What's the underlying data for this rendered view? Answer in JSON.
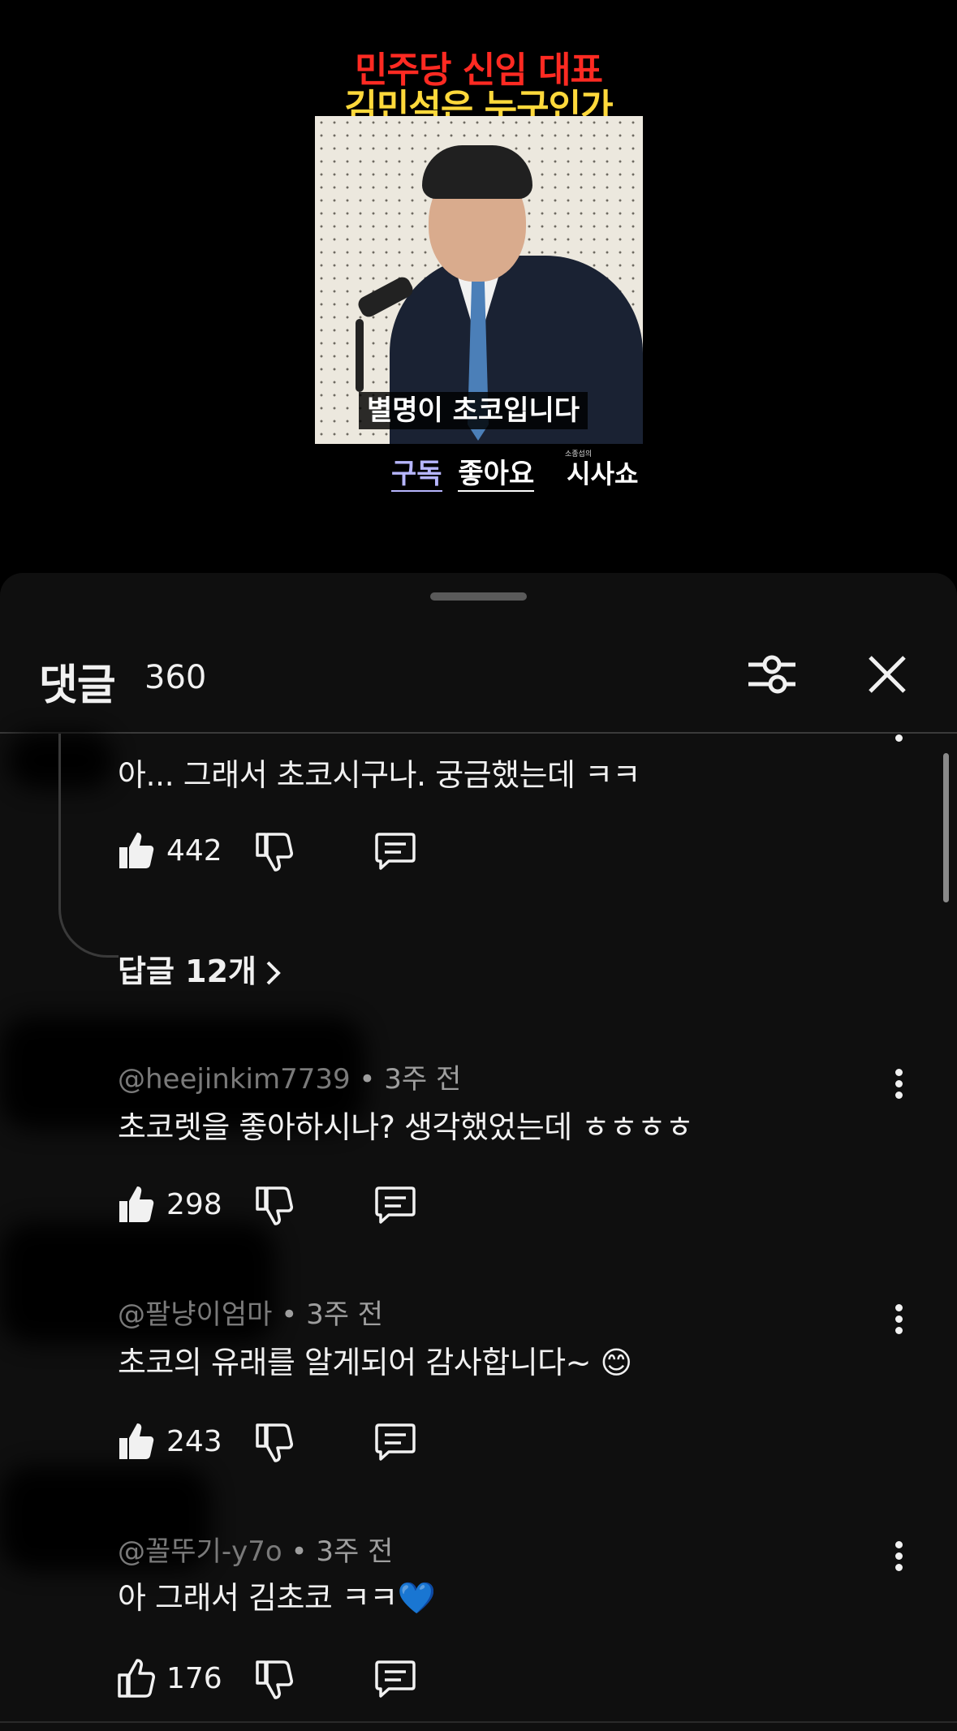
{
  "video": {
    "title_line1": "민주당 신임 대표",
    "title_line2": "김민석은 누구인가",
    "caption": "별명이 초코입니다",
    "subscribe_label": "구독",
    "like_label": "좋아요",
    "channel_small": "소종섭의",
    "channel_name": "시사쇼"
  },
  "comments_panel": {
    "title": "댓글",
    "count": "360",
    "filter_icon": "sliders-icon",
    "close_icon": "close-icon",
    "replies_link": "답글 12개",
    "comments": [
      {
        "user": "",
        "time": "",
        "text": "아... 그래서 초코시구나. 궁금했는데 ㅋㅋ",
        "likes": "442"
      },
      {
        "user": "@heejinkim7739",
        "time": "3주 전",
        "text": "초코렛을 좋아하시나? 생각했었는데 ㅎㅎㅎㅎ",
        "likes": "298"
      },
      {
        "user": "@팔냥이엄마",
        "time": "3주 전",
        "text": "초코의 유래를 알게되어 감사합니다~ 😊",
        "likes": "243"
      },
      {
        "user": "@꼴뚜기-y7o",
        "time": "3주 전",
        "text": "아 그래서 김초코 ㅋㅋ💙",
        "likes": "176"
      }
    ]
  },
  "colors": {
    "sheet_bg": "#0f0f0f",
    "title_red": "#ff2a22",
    "title_yellow": "#ffd93b",
    "subscribe_purple": "#b7b6ff"
  }
}
